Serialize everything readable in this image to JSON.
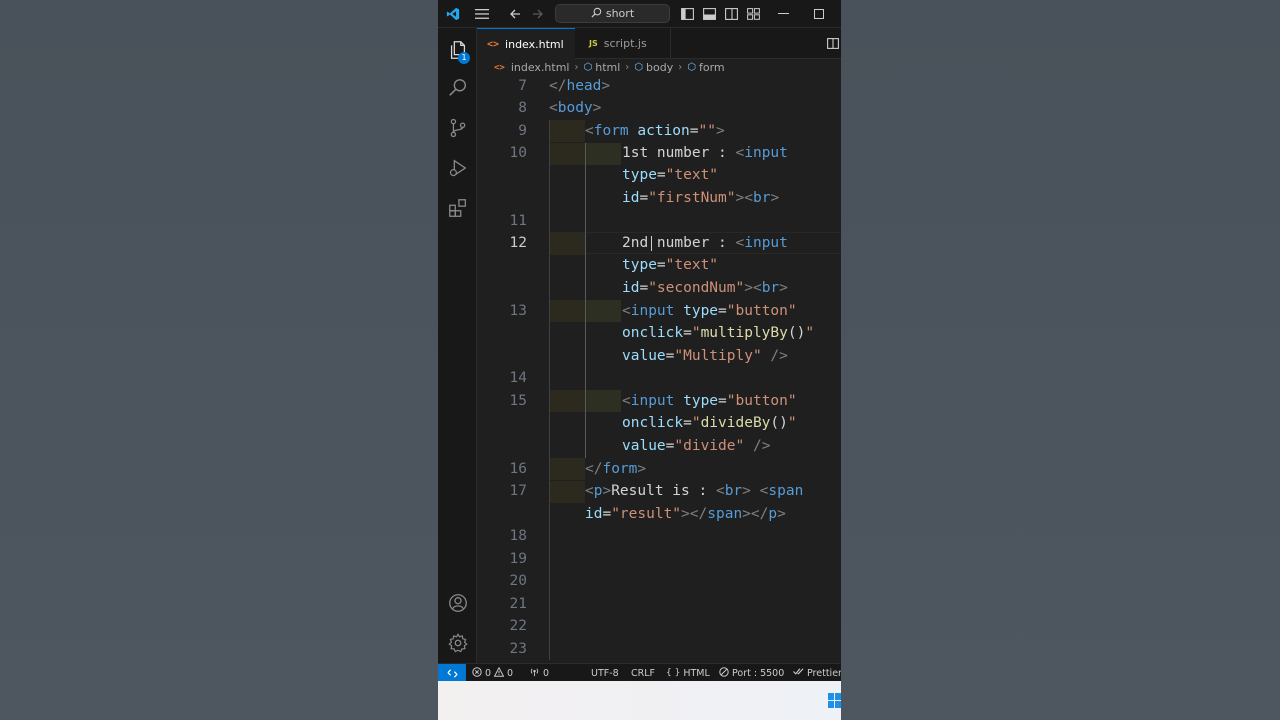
{
  "titlebar": {
    "search_text": "short",
    "search_icon": "search-icon",
    "icons": [
      "vscode-logo-icon",
      "hamburger-menu-icon",
      "arrow-left-icon",
      "arrow-right-icon",
      "toggle-primary-sidebar-icon",
      "toggle-panel-icon",
      "toggle-secondary-sidebar-icon",
      "customize-layout-icon",
      "minimize-icon",
      "maximize-icon"
    ]
  },
  "activity_bar": {
    "items": [
      "explorer-icon",
      "search-icon",
      "source-control-icon",
      "run-debug-icon",
      "extensions-icon"
    ],
    "bottom": [
      "accounts-icon",
      "manage-gear-icon"
    ],
    "explorer_badge": "1"
  },
  "tabs": [
    {
      "label": "index.html",
      "icon": "<>",
      "active": true,
      "modified": true
    },
    {
      "label": "script.js",
      "icon": "JS",
      "active": false,
      "modified": false
    }
  ],
  "breadcrumb": [
    "index.html",
    "html",
    "body",
    "form"
  ],
  "editor": {
    "current_line": "12",
    "lines": [
      {
        "n": "7"
      },
      {
        "n": "8"
      },
      {
        "n": "9"
      },
      {
        "n": "10"
      },
      {
        "n": "11"
      },
      {
        "n": "12"
      },
      {
        "n": "13"
      },
      {
        "n": "14"
      },
      {
        "n": "15"
      },
      {
        "n": "16"
      },
      {
        "n": "17"
      },
      {
        "n": "18"
      },
      {
        "n": "19"
      },
      {
        "n": "20"
      },
      {
        "n": "21"
      },
      {
        "n": "22"
      },
      {
        "n": "23"
      }
    ],
    "code": {
      "l7_close_head_open": "</",
      "l7_head": "head",
      "l7_gt": ">",
      "l8_lt": "<",
      "l8_body": "body",
      "l8_gt": ">",
      "l9_lt": "<",
      "l9_form": "form",
      "l9_attr": " action",
      "l9_eq": "=",
      "l9_val": "\"\"",
      "l9_gt": ">",
      "l10_text": "1st number : ",
      "l10_lt": "<",
      "l10_input": "input",
      "l10b_attr": "type",
      "l10b_eq": "=",
      "l10b_val": "\"text\"",
      "l10c_attr": "id",
      "l10c_eq": "=",
      "l10c_val": "\"firstNum\"",
      "l10c_gt": "><",
      "l10c_br": "br",
      "l10c_end": ">",
      "l12_text": "2nd number : ",
      "l12_lt": "<",
      "l12_input": "input",
      "l12b_attr": "type",
      "l12b_eq": "=",
      "l12b_val": "\"text\"",
      "l12c_attr": "id",
      "l12c_eq": "=",
      "l12c_val": "\"secondNum\"",
      "l12c_gt": "><",
      "l12c_br": "br",
      "l12c_end": ">",
      "l13_lt": "<",
      "l13_input": "input",
      "l13_attr": " type",
      "l13_eq": "=",
      "l13_val": "\"button\"",
      "l13b_attr": "onclick",
      "l13b_eq": "=",
      "l13b_q1": "\"",
      "l13b_fn": "multiplyBy",
      "l13b_paren": "()",
      "l13b_q2": "\"",
      "l13c_attr": "value",
      "l13c_eq": "=",
      "l13c_val": "\"Multiply\"",
      "l13c_end": " />",
      "l15_lt": "<",
      "l15_input": "input",
      "l15_attr": " type",
      "l15_eq": "=",
      "l15_val": "\"button\"",
      "l15b_attr": "onclick",
      "l15b_eq": "=",
      "l15b_q1": "\"",
      "l15b_fn": "divideBy",
      "l15b_paren": "()",
      "l15b_q2": "\"",
      "l15c_attr": "value",
      "l15c_eq": "=",
      "l15c_val": "\"divide\"",
      "l15c_end": " />",
      "l16_lt": "</",
      "l16_form": "form",
      "l16_gt": ">",
      "l17_lt": "<",
      "l17_p": "p",
      "l17_gt": ">",
      "l17_text": "Result is : ",
      "l17_br_lt": "<",
      "l17_br": "br",
      "l17_br_gt": ">",
      "l17_space": " ",
      "l17_span_lt": "<",
      "l17_span": "span",
      "l17b_attr": "id",
      "l17b_eq": "=",
      "l17b_val": "\"result\"",
      "l17b_gt": "></",
      "l17b_span": "span",
      "l17b_mid": "></",
      "l17b_p": "p",
      "l17b_end": ">"
    }
  },
  "statusbar": {
    "errors": "0",
    "warnings": "0",
    "ports": "0",
    "encoding": "UTF-8",
    "eol": "CRLF",
    "language": "HTML",
    "live_server": "Port : 5500",
    "prettier": "Prettier"
  },
  "colors": {
    "accent": "#0078d4",
    "editor_bg": "#1f1f1f",
    "tag": "#569cd6",
    "attr": "#9cdcfe",
    "string": "#ce9178",
    "function": "#dcdcaa"
  }
}
